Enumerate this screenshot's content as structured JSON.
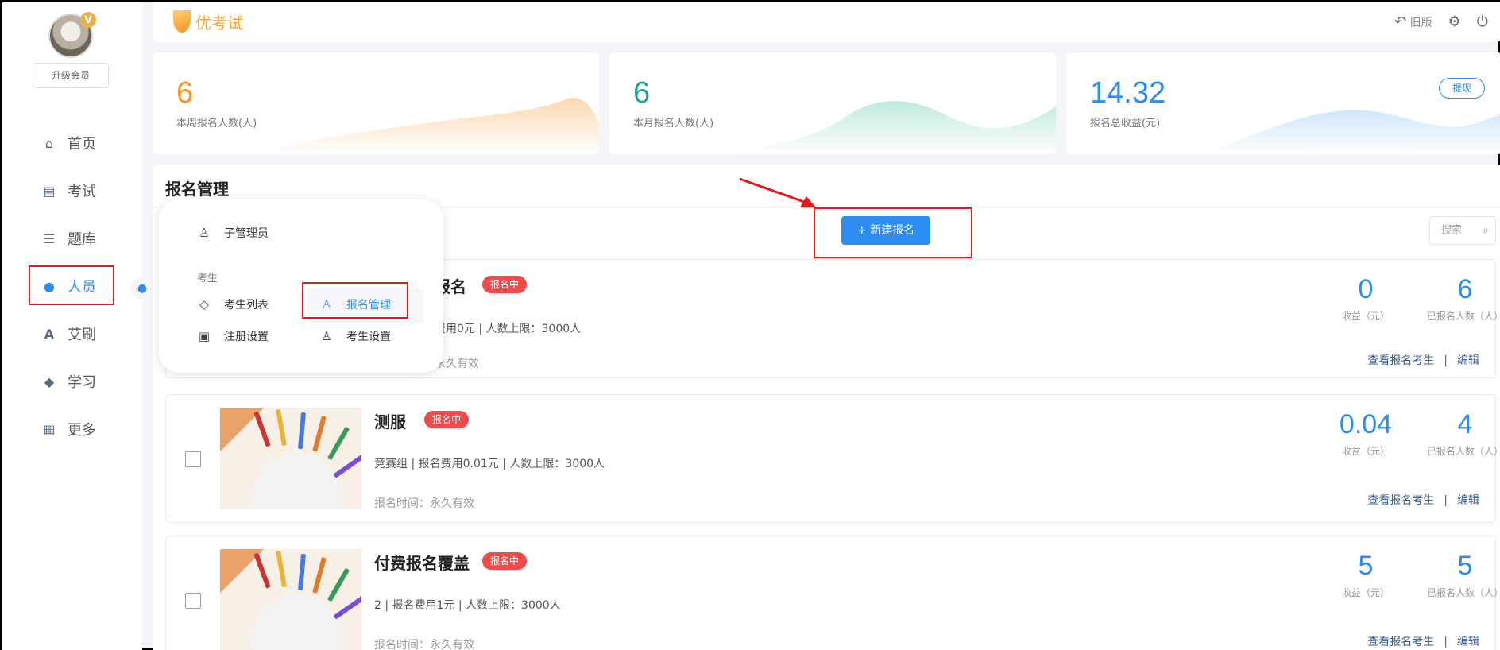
{
  "sidebar": {
    "vip_badge": "V",
    "upgrade_label": "升级会员",
    "items": [
      {
        "label": "首页",
        "icon": "home-icon"
      },
      {
        "label": "考试",
        "icon": "book-icon"
      },
      {
        "label": "题库",
        "icon": "list-icon"
      },
      {
        "label": "人员",
        "icon": "user-icon"
      },
      {
        "label": "艾刷",
        "icon": "letter-a-icon"
      },
      {
        "label": "学习",
        "icon": "graduation-cap-icon"
      },
      {
        "label": "更多",
        "icon": "grid-icon"
      }
    ],
    "active": "人员"
  },
  "topbar": {
    "logo_text": "优考试",
    "old_version_label": "旧版"
  },
  "stats": [
    {
      "value": "6",
      "label": "本周报名人数(人)",
      "color": "#f7932a"
    },
    {
      "value": "6",
      "label": "本月报名人数(人)",
      "color": "#21a393"
    },
    {
      "value": "14.32",
      "label": "报名总收益(元)",
      "color": "#2d8cf0",
      "button": "提现"
    }
  ],
  "main": {
    "title": "报名管理",
    "new_button_label": "+ 新建报名",
    "search_placeholder": "搜索",
    "income_label": "收益（元）",
    "enrolled_label": "已报名人数（人）",
    "view_label": "查看报名考生",
    "edit_label": "编辑",
    "separator": "|",
    "exams": [
      {
        "title": "报名",
        "status": "报名中",
        "meta": "费用0元 | 人数上限：3000人",
        "time": "永久有效",
        "income": "0",
        "enrolled": "6"
      },
      {
        "title": "测服",
        "status": "报名中",
        "meta": "竞赛组 | 报名费用0.01元 | 人数上限：3000人",
        "time": "报名时间：永久有效",
        "income": "0.04",
        "enrolled": "4"
      },
      {
        "title": "付费报名覆盖",
        "status": "报名中",
        "meta": "2 | 报名费用1元 | 人数上限：3000人",
        "time": "报名时间：永久有效",
        "income": "5",
        "enrolled": "5"
      }
    ]
  },
  "popup": {
    "admin_label": "子管理员",
    "group_label": "考生",
    "items": [
      {
        "label": "考生列表",
        "icon": "graduation-cap-icon"
      },
      {
        "label": "报名管理",
        "icon": "user-add-icon"
      },
      {
        "label": "注册设置",
        "icon": "register-settings-icon"
      },
      {
        "label": "考生设置",
        "icon": "user-settings-icon"
      }
    ],
    "active": "报名管理"
  }
}
